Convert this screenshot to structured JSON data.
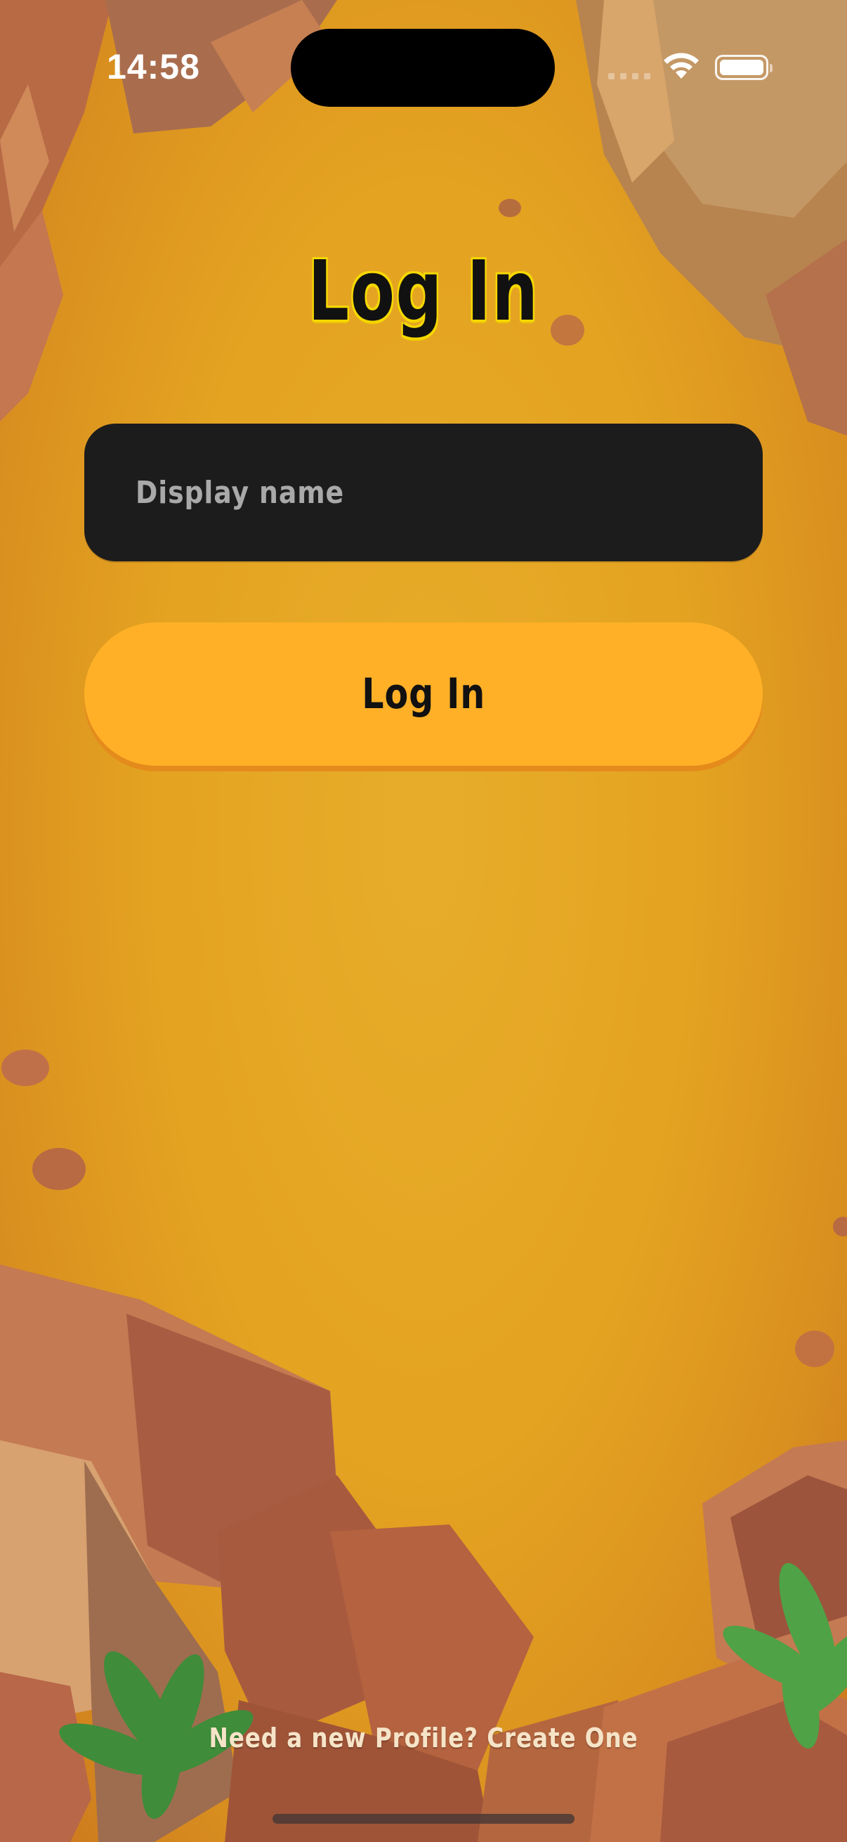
{
  "status_bar": {
    "time": "14:58"
  },
  "screen": {
    "title": "Log In"
  },
  "form": {
    "display_name_placeholder": "Display name",
    "login_button_label": "Log In"
  },
  "footer": {
    "create_profile_link": "Need a new Profile? Create One"
  },
  "colors": {
    "background": "#e4a321",
    "input_background": "#1c1c1c",
    "button": "#ffb027",
    "title_outline": "#f5d800"
  },
  "icons": [
    "wifi-icon",
    "battery-icon",
    "signal-icon"
  ]
}
